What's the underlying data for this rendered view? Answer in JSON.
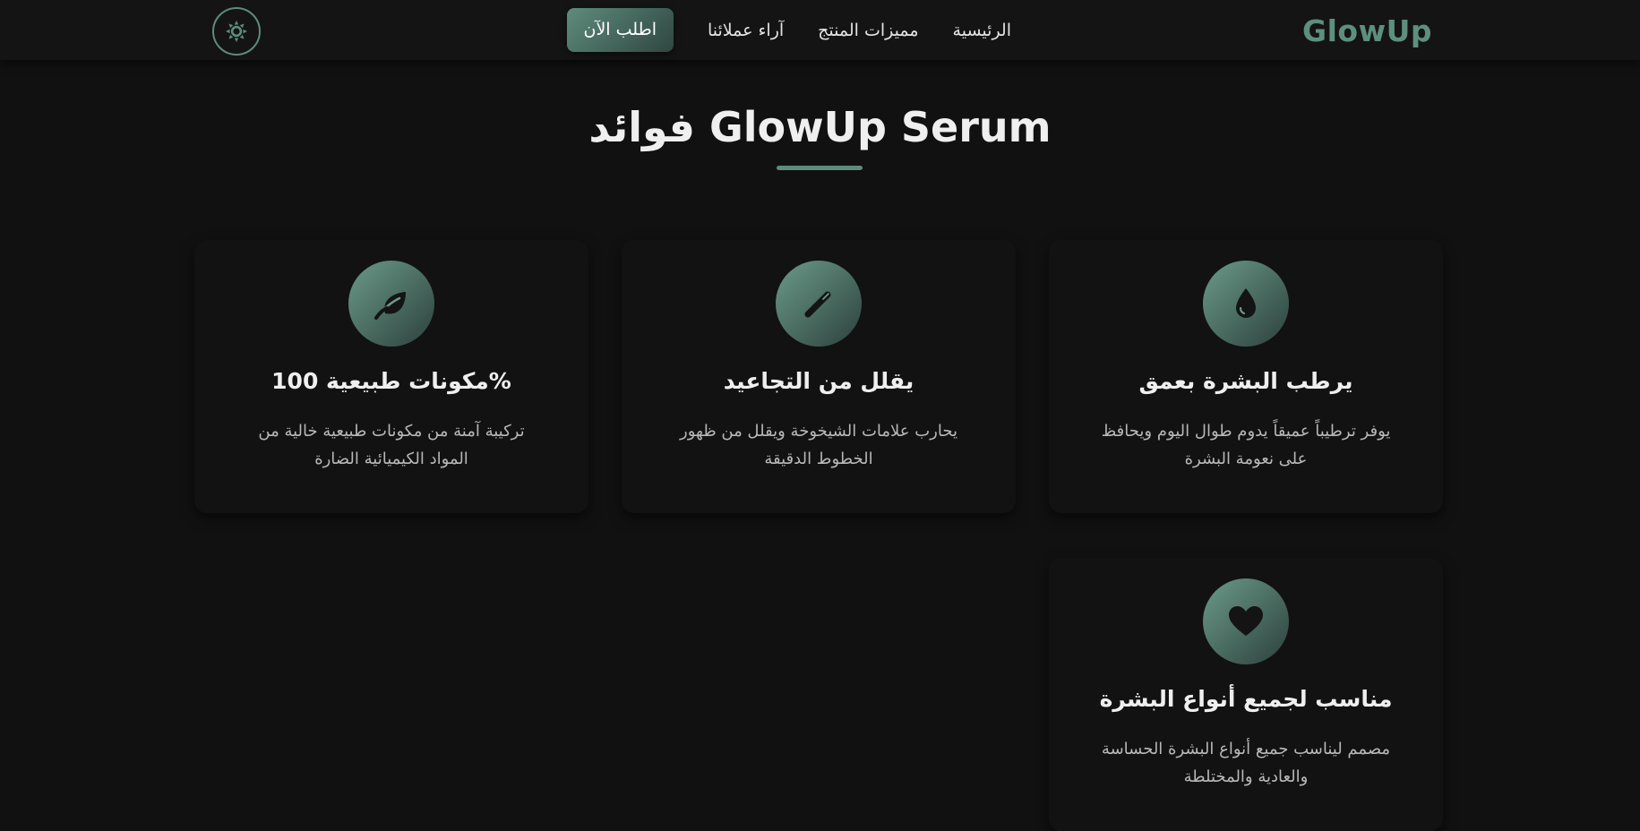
{
  "navbar": {
    "brand": "GlowUp",
    "links": [
      {
        "label": "الرئيسية"
      },
      {
        "label": "مميزات المنتج"
      },
      {
        "label": "آراء عملائنا"
      }
    ],
    "cta_label": "اطلب الآن",
    "theme_toggle_icon": "sun-icon"
  },
  "section": {
    "title": "فوائد GlowUp Serum"
  },
  "features": [
    {
      "icon": "droplet-icon",
      "title": "يرطب البشرة بعمق",
      "description": "يوفر ترطيباً عميقاً يدوم طوال اليوم ويحافظ على نعومة البشرة"
    },
    {
      "icon": "magic-wand-icon",
      "title": "يقلل من التجاعيد",
      "description": "يحارب علامات الشيخوخة ويقلل من ظهور الخطوط الدقيقة"
    },
    {
      "icon": "leaf-icon",
      "title": "مكونات طبيعية 100%",
      "description": "تركيبة آمنة من مكونات طبيعية خالية من المواد الكيميائية الضارة"
    },
    {
      "icon": "heart-icon",
      "title": "مناسب لجميع أنواع البشرة",
      "description": "مصمم ليناسب جميع أنواع البشرة الحساسة والعادية والمختلطة"
    }
  ],
  "colors": {
    "accent": "#5e8b7c",
    "background": "#111111",
    "card": "#121212"
  }
}
